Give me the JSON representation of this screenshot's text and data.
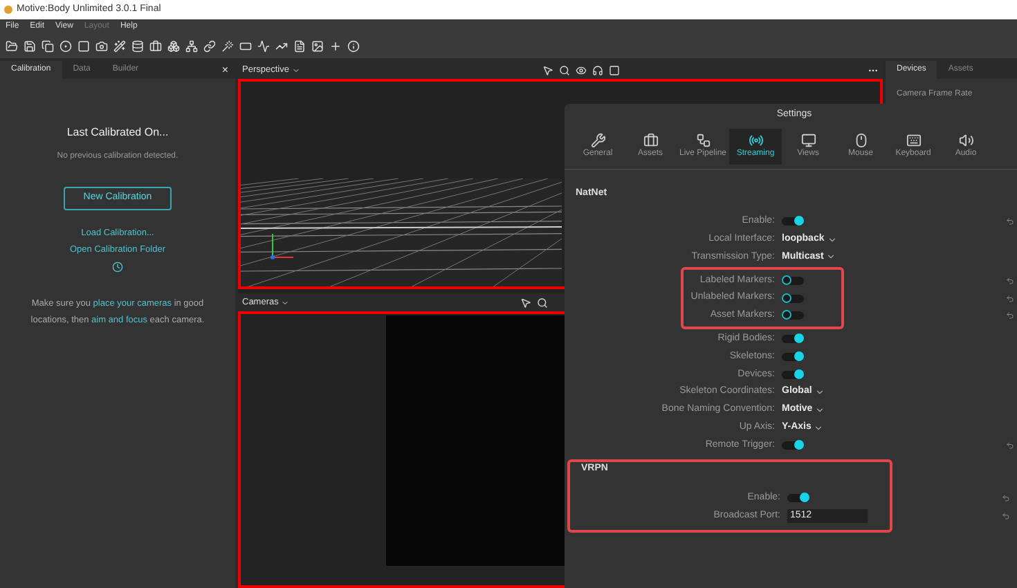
{
  "window": {
    "title": "Motive:Body Unlimited 3.0.1 Final"
  },
  "menu": [
    {
      "label": "File",
      "disabled": false
    },
    {
      "label": "Edit",
      "disabled": false
    },
    {
      "label": "View",
      "disabled": false
    },
    {
      "label": "Layout",
      "disabled": true
    },
    {
      "label": "Help",
      "disabled": false
    }
  ],
  "left_panel": {
    "tabs": [
      {
        "label": "Calibration",
        "selected": true
      },
      {
        "label": "Data",
        "selected": false
      },
      {
        "label": "Builder",
        "selected": false
      }
    ],
    "close": "×",
    "heading": "Last Calibrated On...",
    "status": "No previous calibration detected.",
    "new_button": "New Calibration",
    "links": [
      "Load Calibration...",
      "Open Calibration Folder"
    ],
    "hint": [
      {
        "text": "Make sure you ",
        "link": false
      },
      {
        "text": "place your cameras",
        "link": true
      },
      {
        "text": " in good locations, then ",
        "link": false
      },
      {
        "text": "aim and focus",
        "link": true
      },
      {
        "text": " each camera.",
        "link": false
      }
    ]
  },
  "viewports": [
    {
      "label": "Perspective",
      "kind": "grid"
    },
    {
      "label": "Cameras",
      "kind": "camera"
    }
  ],
  "right_panel": {
    "tabs": [
      {
        "label": "Devices",
        "selected": true
      },
      {
        "label": "Assets",
        "selected": false
      }
    ],
    "first_item": "Camera Frame Rate"
  },
  "settings": {
    "title": "Settings",
    "tabs": [
      {
        "label": "General",
        "selected": false
      },
      {
        "label": "Assets",
        "selected": false
      },
      {
        "label": "Live Pipeline",
        "selected": false
      },
      {
        "label": "Streaming",
        "selected": true
      },
      {
        "label": "Views",
        "selected": false
      },
      {
        "label": "Mouse",
        "selected": false
      },
      {
        "label": "Keyboard",
        "selected": false
      },
      {
        "label": "Audio",
        "selected": false
      }
    ],
    "sections": [
      {
        "title": "NatNet",
        "highlighted": false,
        "rows": [
          {
            "label": "Enable:",
            "kind": "toggle",
            "on": true,
            "highlighted": false,
            "reset": true
          },
          {
            "label": "Local Interface:",
            "kind": "dropdown",
            "value": "loopback",
            "highlighted": false,
            "reset": false
          },
          {
            "label": "Transmission Type:",
            "kind": "dropdown",
            "value": "Multicast",
            "highlighted": false,
            "reset": false
          },
          {
            "label": "Labeled Markers:",
            "kind": "toggle",
            "on": false,
            "highlighted": true,
            "reset": true
          },
          {
            "label": "Unlabeled Markers:",
            "kind": "toggle",
            "on": false,
            "highlighted": true,
            "reset": true
          },
          {
            "label": "Asset Markers:",
            "kind": "toggle",
            "on": false,
            "highlighted": true,
            "reset": true
          },
          {
            "label": "Rigid Bodies:",
            "kind": "toggle",
            "on": true,
            "highlighted": false,
            "reset": false
          },
          {
            "label": "Skeletons:",
            "kind": "toggle",
            "on": true,
            "highlighted": false,
            "reset": false
          },
          {
            "label": "Devices:",
            "kind": "toggle",
            "on": true,
            "highlighted": false,
            "reset": false
          },
          {
            "label": "Skeleton Coordinates:",
            "kind": "dropdown",
            "value": "Global",
            "highlighted": false,
            "reset": false
          },
          {
            "label": "Bone Naming Convention:",
            "kind": "dropdown",
            "value": "Motive",
            "highlighted": false,
            "reset": false
          },
          {
            "label": "Up Axis:",
            "kind": "dropdown",
            "value": "Y-Axis",
            "highlighted": false,
            "reset": false
          },
          {
            "label": "Remote Trigger:",
            "kind": "toggle",
            "on": true,
            "highlighted": false,
            "reset": true
          }
        ]
      },
      {
        "title": "VRPN",
        "highlighted": true,
        "rows": [
          {
            "label": "Enable:",
            "kind": "toggle",
            "on": true,
            "highlighted": false,
            "reset": true
          },
          {
            "label": "Broadcast Port:",
            "kind": "input",
            "value": "1512",
            "highlighted": false,
            "reset": true
          }
        ]
      }
    ]
  }
}
